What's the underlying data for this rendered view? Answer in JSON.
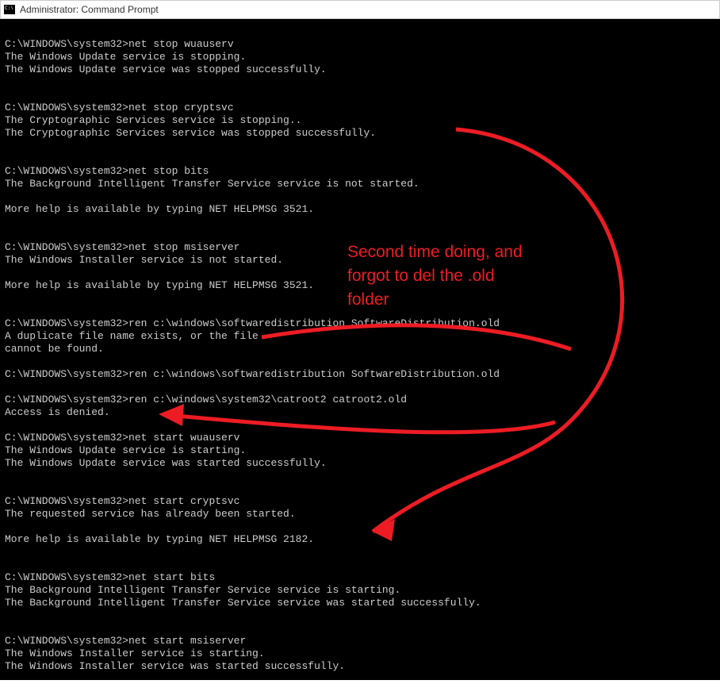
{
  "window": {
    "title": "Administrator: Command Prompt"
  },
  "prompt": "C:\\WINDOWS\\system32>",
  "blocks": [
    {
      "cmd": "net stop wuauserv",
      "out": [
        "The Windows Update service is stopping.",
        "The Windows Update service was stopped successfully."
      ],
      "trail_blank": 2
    },
    {
      "cmd": "net stop cryptsvc",
      "out": [
        "The Cryptographic Services service is stopping..",
        "The Cryptographic Services service was stopped successfully."
      ],
      "trail_blank": 2
    },
    {
      "cmd": "net stop bits",
      "out": [
        "The Background Intelligent Transfer Service service is not started.",
        "",
        "More help is available by typing NET HELPMSG 3521."
      ],
      "trail_blank": 2
    },
    {
      "cmd": "net stop msiserver",
      "out": [
        "The Windows Installer service is not started.",
        "",
        "More help is available by typing NET HELPMSG 3521."
      ],
      "trail_blank": 2
    },
    {
      "cmd": "ren c:\\windows\\softwaredistribution SoftwareDistribution.old",
      "out": [
        "A duplicate file name exists, or the file",
        "cannot be found."
      ],
      "trail_blank": 1
    },
    {
      "cmd": "ren c:\\windows\\softwaredistribution SoftwareDistribution.old",
      "out": [],
      "trail_blank": 1
    },
    {
      "cmd": "ren c:\\windows\\system32\\catroot2 catroot2.old",
      "out": [
        "Access is denied."
      ],
      "trail_blank": 1
    },
    {
      "cmd": "net start wuauserv",
      "out": [
        "The Windows Update service is starting.",
        "The Windows Update service was started successfully."
      ],
      "trail_blank": 2
    },
    {
      "cmd": "net start cryptsvc",
      "out": [
        "The requested service has already been started.",
        "",
        "More help is available by typing NET HELPMSG 2182."
      ],
      "trail_blank": 2
    },
    {
      "cmd": "net start bits",
      "out": [
        "The Background Intelligent Transfer Service service is starting.",
        "The Background Intelligent Transfer Service service was started successfully."
      ],
      "trail_blank": 2
    },
    {
      "cmd": "net start msiserver",
      "out": [
        "The Windows Installer service is starting.",
        "The Windows Installer service was started successfully."
      ],
      "trail_blank": 0
    }
  ],
  "annotation": {
    "text": "Second time doing, and\nforgot to del the .old\nfolder"
  }
}
